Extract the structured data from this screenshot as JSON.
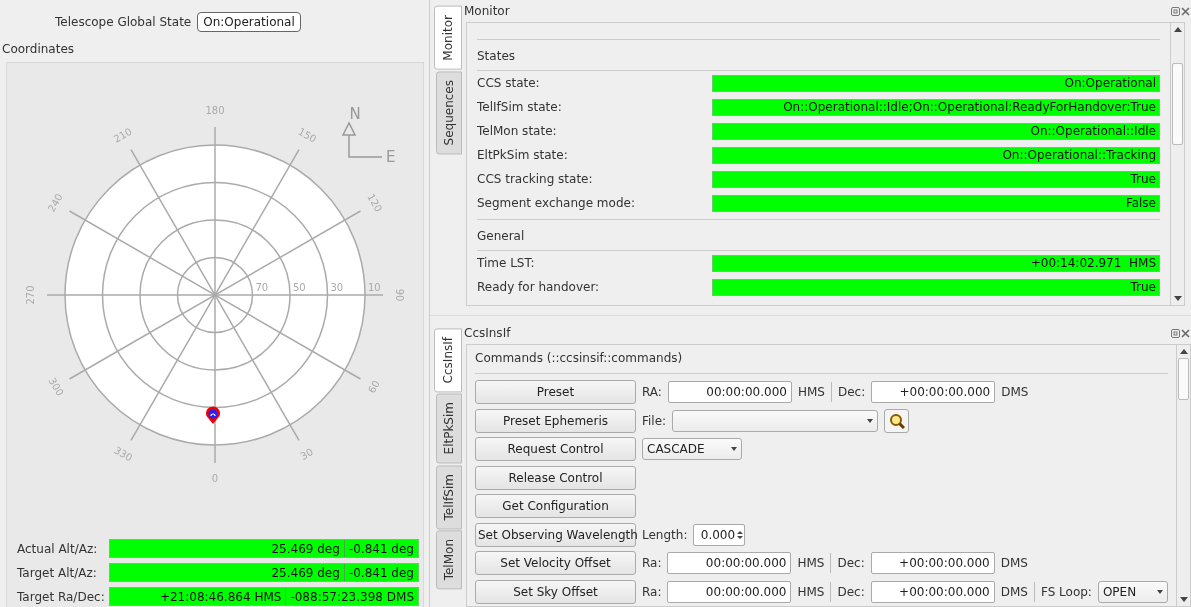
{
  "global_state": {
    "label": "Telescope Global State",
    "value": "On:Operational"
  },
  "coordinates": {
    "title": "Coordinates",
    "sky_plot": {
      "azimuth_labels": [
        "180",
        "210",
        "150",
        "240",
        "120",
        "270",
        "90",
        "300",
        "60",
        "330",
        "30",
        "0"
      ],
      "altitude_labels": [
        "70",
        "50",
        "30",
        "10"
      ],
      "compass": {
        "north": "N",
        "east": "E"
      }
    },
    "readouts": [
      {
        "label": "Actual Alt/Az:",
        "values": [
          "25.469 deg",
          "-0.841 deg"
        ]
      },
      {
        "label": "Target Alt/Az:",
        "values": [
          "25.469 deg",
          "-0.841 deg"
        ]
      },
      {
        "label": "Target Ra/Dec:",
        "values": [
          "+21:08:46.864 HMS",
          "-088:57:23.398 DMS"
        ]
      }
    ]
  },
  "monitor": {
    "title": "Monitor",
    "tabs": [
      {
        "label": "Monitor",
        "selected": true
      },
      {
        "label": "Sequences",
        "selected": false
      }
    ],
    "sections": [
      {
        "title": "States",
        "rows": [
          {
            "label": "CCS state:",
            "value": "On:Operational"
          },
          {
            "label": "TelIfSim state:",
            "value": "On::Operational::Idle;On::Operational:ReadyForHandover:True"
          },
          {
            "label": "TelMon state:",
            "value": "On::Operational::Idle"
          },
          {
            "label": "EltPkSim state:",
            "value": "On::Operational::Tracking"
          },
          {
            "label": "CCS tracking state:",
            "value": "True"
          },
          {
            "label": "Segment exchange mode:",
            "value": "False"
          }
        ]
      },
      {
        "title": "General",
        "rows": [
          {
            "label": "Time LST:",
            "value": "+00:14:02.971  HMS"
          },
          {
            "label": "Ready for handover:",
            "value": "True"
          }
        ]
      }
    ]
  },
  "ccsinsif": {
    "title": "CcsInsIf",
    "tabs": [
      {
        "label": "CcsInsIf",
        "selected": true
      },
      {
        "label": "EltPkSim",
        "selected": false
      },
      {
        "label": "TelIfSim",
        "selected": false
      },
      {
        "label": "TelMon",
        "selected": false
      }
    ],
    "heading": "Commands (::ccsinsif::commands)",
    "rows": [
      {
        "button": "Preset",
        "fields": [
          {
            "kind": "label",
            "text": "RA:"
          },
          {
            "kind": "input",
            "value": "00:00:00.000"
          },
          {
            "kind": "unit",
            "text": "HMS"
          },
          {
            "kind": "separator"
          },
          {
            "kind": "label",
            "text": "Dec:"
          },
          {
            "kind": "input",
            "value": "+00:00:00.000"
          },
          {
            "kind": "unit",
            "text": "DMS"
          }
        ]
      },
      {
        "button": "Preset Ephemeris",
        "fields": [
          {
            "kind": "label",
            "text": "File:"
          },
          {
            "kind": "combo"
          },
          {
            "kind": "search"
          }
        ]
      },
      {
        "button": "Request Control",
        "fields": [
          {
            "kind": "combo",
            "value": "CASCADE"
          }
        ]
      },
      {
        "button": "Release Control",
        "fields": []
      },
      {
        "button": "Get Configuration",
        "fields": []
      },
      {
        "button": "Set Observing Wavelength",
        "fields": [
          {
            "kind": "label",
            "text": "Length:"
          },
          {
            "kind": "spin",
            "value": "0.000"
          }
        ]
      },
      {
        "button": "Set Velocity Offset",
        "fields": [
          {
            "kind": "label",
            "text": "Ra:"
          },
          {
            "kind": "input",
            "value": "00:00:00.000"
          },
          {
            "kind": "unit",
            "text": "HMS"
          },
          {
            "kind": "separator"
          },
          {
            "kind": "label",
            "text": "Dec:"
          },
          {
            "kind": "input",
            "value": "+00:00:00.000"
          },
          {
            "kind": "unit",
            "text": "DMS"
          }
        ]
      },
      {
        "button": "Set Sky Offset",
        "fields": [
          {
            "kind": "label",
            "text": "Ra:"
          },
          {
            "kind": "input",
            "value": "00:00:00.000"
          },
          {
            "kind": "unit",
            "text": "HMS"
          },
          {
            "kind": "separator"
          },
          {
            "kind": "label",
            "text": "Dec:"
          },
          {
            "kind": "input",
            "value": "+00:00:00.000"
          },
          {
            "kind": "unit",
            "text": "DMS"
          },
          {
            "kind": "separator"
          },
          {
            "kind": "label",
            "text": "FS Loop:"
          },
          {
            "kind": "combo",
            "value": "OPEN"
          }
        ]
      }
    ]
  }
}
